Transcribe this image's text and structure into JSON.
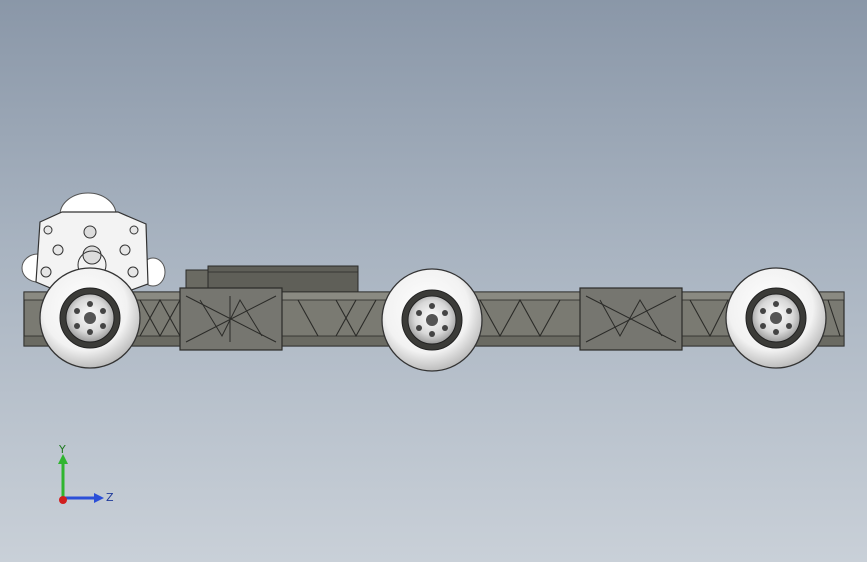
{
  "viewport": {
    "background_top": "#8a97a8",
    "background_bottom": "#c9d0d8"
  },
  "model": {
    "frame_color": "#6e6e66",
    "frame_dark": "#3a3a36",
    "wheel_color": "#ffffff",
    "wheel_count": 3
  },
  "triad": {
    "y_label": "Y",
    "z_label": "Z",
    "y_color": "#2fb52f",
    "z_color": "#2b4fd8",
    "x_color": "#d11e1e"
  }
}
